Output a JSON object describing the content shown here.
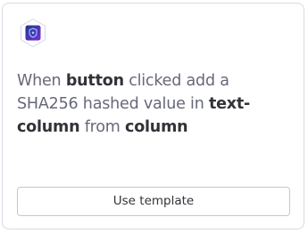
{
  "card": {
    "app_icon": "hexagon-shield-icon",
    "recipe": {
      "t1": "When ",
      "b1": "button",
      "t2": " clicked add a SHA256 hashed value in ",
      "b2": "text-column",
      "t3": " from ",
      "b3": "column"
    },
    "button_label": "Use template"
  },
  "colors": {
    "text_muted": "#676879",
    "text_strong": "#323338",
    "border": "#d9d9e3",
    "icon_gradient_start": "#1b3a8f",
    "icon_gradient_end": "#7b2fd6"
  }
}
